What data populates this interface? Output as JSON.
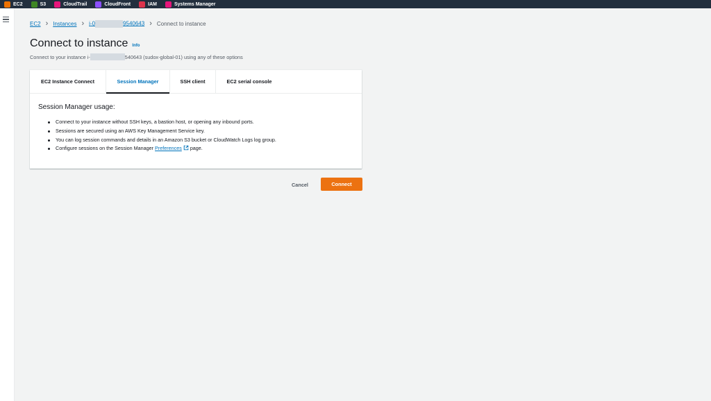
{
  "top_bar": {
    "services": [
      {
        "label": "EC2",
        "icon": "ec2-icon",
        "color": "#ed7100"
      },
      {
        "label": "S3",
        "icon": "s3-icon",
        "color": "#3f8624"
      },
      {
        "label": "CloudTrail",
        "icon": "cloudtrail-icon",
        "color": "#e7157b"
      },
      {
        "label": "CloudFront",
        "icon": "cloudfront-icon",
        "color": "#8c4fff"
      },
      {
        "label": "IAM",
        "icon": "iam-icon",
        "color": "#dd344c"
      },
      {
        "label": "Systems Manager",
        "icon": "systems-manager-icon",
        "color": "#e7157b"
      }
    ]
  },
  "nav": {
    "menu_icon": "hamburger-icon"
  },
  "breadcrumb": {
    "items": [
      "EC2",
      "Instances"
    ],
    "instance_prefix": "i-0",
    "instance_suffix": "9540643",
    "current": "Connect to instance"
  },
  "header": {
    "title": "Connect to instance",
    "info": "Info",
    "subtitle_before": "Connect to your instance i-",
    "subtitle_after": "540643 (sudox-global-01) using any of these options"
  },
  "tabs": [
    {
      "label": "EC2 Instance Connect",
      "active": false
    },
    {
      "label": "Session Manager",
      "active": true
    },
    {
      "label": "SSH client",
      "active": false
    },
    {
      "label": "EC2 serial console",
      "active": false
    }
  ],
  "session_manager": {
    "title": "Session Manager usage:",
    "items": [
      "Connect to your instance without SSH keys, a bastion host, or opening any inbound ports.",
      "Sessions are secured using an AWS Key Management Service key.",
      "You can log session commands and details in an Amazon S3 bucket or CloudWatch Logs log group."
    ],
    "last_item_before": "Configure sessions on the Session Manager",
    "last_item_link": "Preferences",
    "last_item_after": "page."
  },
  "actions": {
    "cancel": "Cancel",
    "connect": "Connect"
  },
  "colors": {
    "accent": "#0073bb",
    "primary_button": "#ec7211",
    "topbar": "#232f3e"
  }
}
